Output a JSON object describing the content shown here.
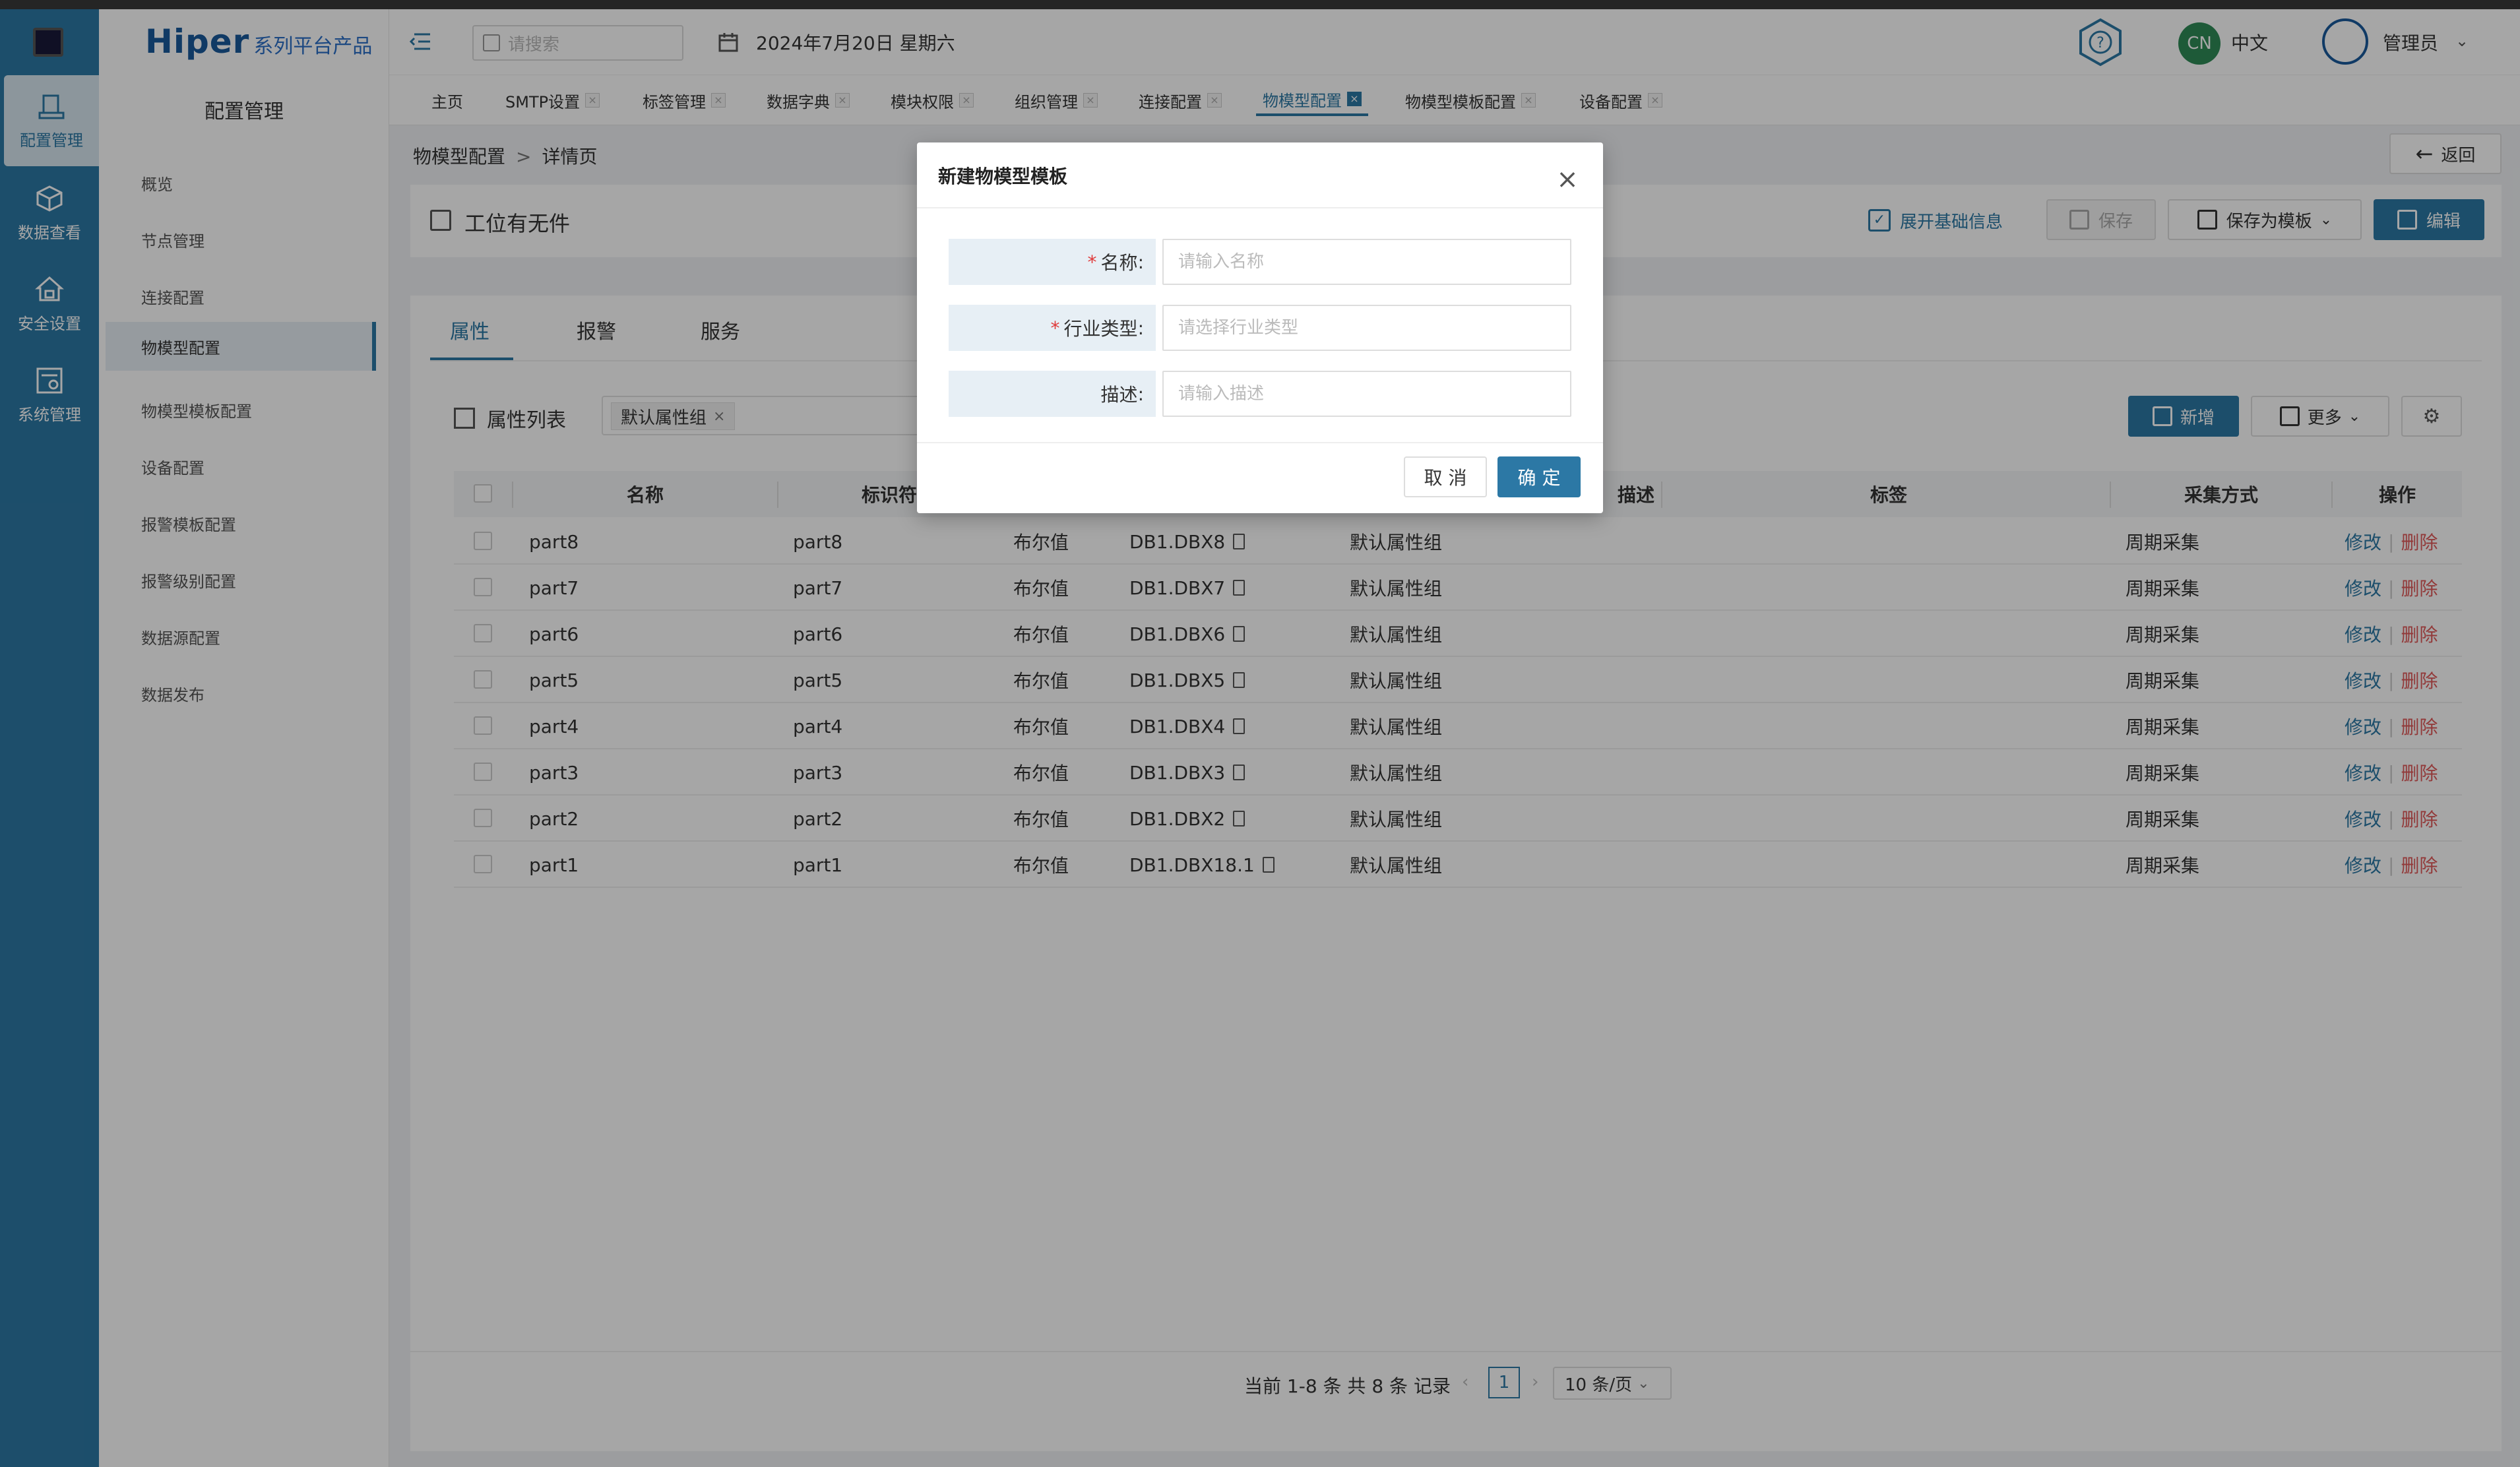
{
  "header": {
    "search_placeholder": "请搜索",
    "date": "2024年7月20日 星期六",
    "lang_badge": "CN",
    "lang": "中文",
    "user": "管理员"
  },
  "brand": {
    "main": "Hiper",
    "sub": "系列平台产品"
  },
  "rail": [
    {
      "label": "配置管理",
      "icon": "config-icon",
      "active": true
    },
    {
      "label": "数据查看",
      "icon": "cube-icon"
    },
    {
      "label": "安全设置",
      "icon": "security-icon"
    },
    {
      "label": "系统管理",
      "icon": "system-icon"
    }
  ],
  "submenu": {
    "title": "配置管理",
    "items": [
      "概览",
      "节点管理",
      "连接配置",
      "物模型配置",
      "物模型模板配置",
      "设备配置",
      "报警模板配置",
      "报警级别配置",
      "数据源配置",
      "数据发布"
    ],
    "active_index": 3
  },
  "tabs": [
    "主页",
    "SMTP设置",
    "标签管理",
    "数据字典",
    "模块权限",
    "组织管理",
    "连接配置",
    "物模型配置",
    "物模型模板配置",
    "设备配置"
  ],
  "active_tab": 7,
  "breadcrumb": {
    "parent": "物模型配置",
    "sep": ">",
    "current": "详情页"
  },
  "back_label": "返回",
  "title_card": {
    "title": "工位有无件",
    "expand": "展开基础信息",
    "save": "保存",
    "save_template": "保存为模板",
    "edit": "编辑"
  },
  "main_tabs": [
    "属性",
    "报警",
    "服务"
  ],
  "property_list": {
    "title": "属性列表",
    "filter_tag": "默认属性组",
    "add": "新增",
    "more": "更多"
  },
  "table": {
    "columns": [
      "名称",
      "标识符",
      "描述",
      "标签",
      "采集方式",
      "操作"
    ],
    "op_edit": "修改",
    "op_delete": "删除",
    "rows": [
      {
        "name": "part8",
        "id": "part8",
        "type": "布尔值",
        "addr": "DB1.DBX8",
        "group": "默认属性组",
        "mode": "周期采集"
      },
      {
        "name": "part7",
        "id": "part7",
        "type": "布尔值",
        "addr": "DB1.DBX7",
        "group": "默认属性组",
        "mode": "周期采集"
      },
      {
        "name": "part6",
        "id": "part6",
        "type": "布尔值",
        "addr": "DB1.DBX6",
        "group": "默认属性组",
        "mode": "周期采集"
      },
      {
        "name": "part5",
        "id": "part5",
        "type": "布尔值",
        "addr": "DB1.DBX5",
        "group": "默认属性组",
        "mode": "周期采集"
      },
      {
        "name": "part4",
        "id": "part4",
        "type": "布尔值",
        "addr": "DB1.DBX4",
        "group": "默认属性组",
        "mode": "周期采集"
      },
      {
        "name": "part3",
        "id": "part3",
        "type": "布尔值",
        "addr": "DB1.DBX3",
        "group": "默认属性组",
        "mode": "周期采集"
      },
      {
        "name": "part2",
        "id": "part2",
        "type": "布尔值",
        "addr": "DB1.DBX2",
        "group": "默认属性组",
        "mode": "周期采集"
      },
      {
        "name": "part1",
        "id": "part1",
        "type": "布尔值",
        "addr": "DB1.DBX18.1",
        "group": "默认属性组",
        "mode": "周期采集"
      }
    ]
  },
  "pagination": {
    "info": "当前 1-8 条 共 8 条 记录",
    "current": "1",
    "page_size": "10 条/页"
  },
  "modal": {
    "title": "新建物模型模板",
    "fields": [
      {
        "label": "名称",
        "required": true,
        "placeholder": "请输入名称"
      },
      {
        "label": "行业类型",
        "required": true,
        "placeholder": "请选择行业类型"
      },
      {
        "label": "描述",
        "required": false,
        "placeholder": "请输入描述"
      }
    ],
    "cancel": "取 消",
    "ok": "确 定"
  },
  "colors": {
    "primary": "#2c78a5",
    "danger": "#e05a5a",
    "required": "#e03a3a",
    "rail": "#2c78a5"
  }
}
